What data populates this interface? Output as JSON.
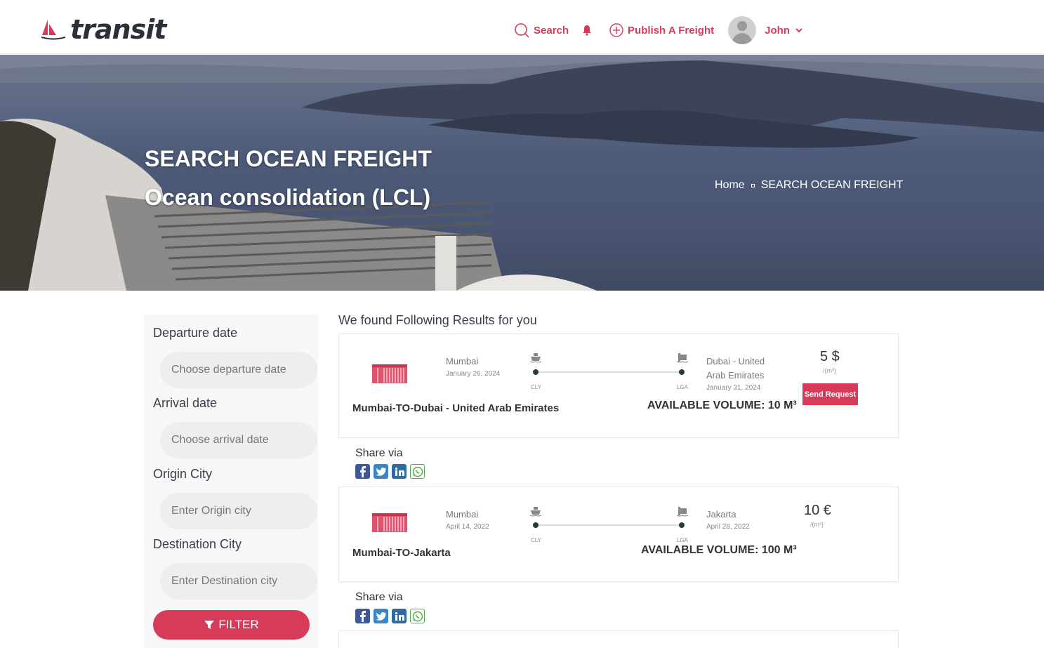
{
  "header": {
    "logo_text": "transit",
    "nav": {
      "search_label": "Search",
      "publish_label": "Publish A Freight",
      "user_name": "John"
    }
  },
  "hero": {
    "title": "SEARCH OCEAN FREIGHT",
    "subtitle": "Ocean consolidation (LCL)",
    "breadcrumb": {
      "home": "Home",
      "current": "SEARCH OCEAN FREIGHT"
    }
  },
  "sidebar": {
    "departure_label": "Departure date",
    "departure_placeholder": "Choose departure date",
    "arrival_label": "Arrival date",
    "arrival_placeholder": "Choose arrival date",
    "origin_label": "Origin City",
    "origin_placeholder": "Enter Origin city",
    "destination_label": "Destination City",
    "destination_placeholder": "Enter Destination city",
    "filter_label": "FILTER"
  },
  "results": {
    "title": "We found Following Results for you",
    "share_label": "Share via",
    "items": [
      {
        "origin_city": "Mumbai",
        "origin_date": "January 26, 2024",
        "origin_code": "CLY",
        "dest_city_line1": "Dubai - United",
        "dest_city_line2": "Arab Emirates",
        "dest_date": "January 31, 2024",
        "dest_code": "LGA",
        "route": "Mumbai-TO-Dubai - United Arab Emirates",
        "volume": "AVAILABLE VOLUME: 10 M³",
        "price": "5 $",
        "unit": "/(m³)",
        "button": "Send Request"
      },
      {
        "origin_city": "Mumbai",
        "origin_date": "April 14, 2022",
        "origin_code": "CLY",
        "dest_city_line1": "Jakarta",
        "dest_date": "April 28, 2022",
        "dest_code": "LGA",
        "route": "Mumbai-TO-Jakarta",
        "volume": "AVAILABLE VOLUME: 100 M³",
        "price": "10 €",
        "unit": "/(m³)"
      }
    ]
  },
  "colors": {
    "accent": "#d63b5a",
    "text_dark": "#3b3f4c"
  }
}
